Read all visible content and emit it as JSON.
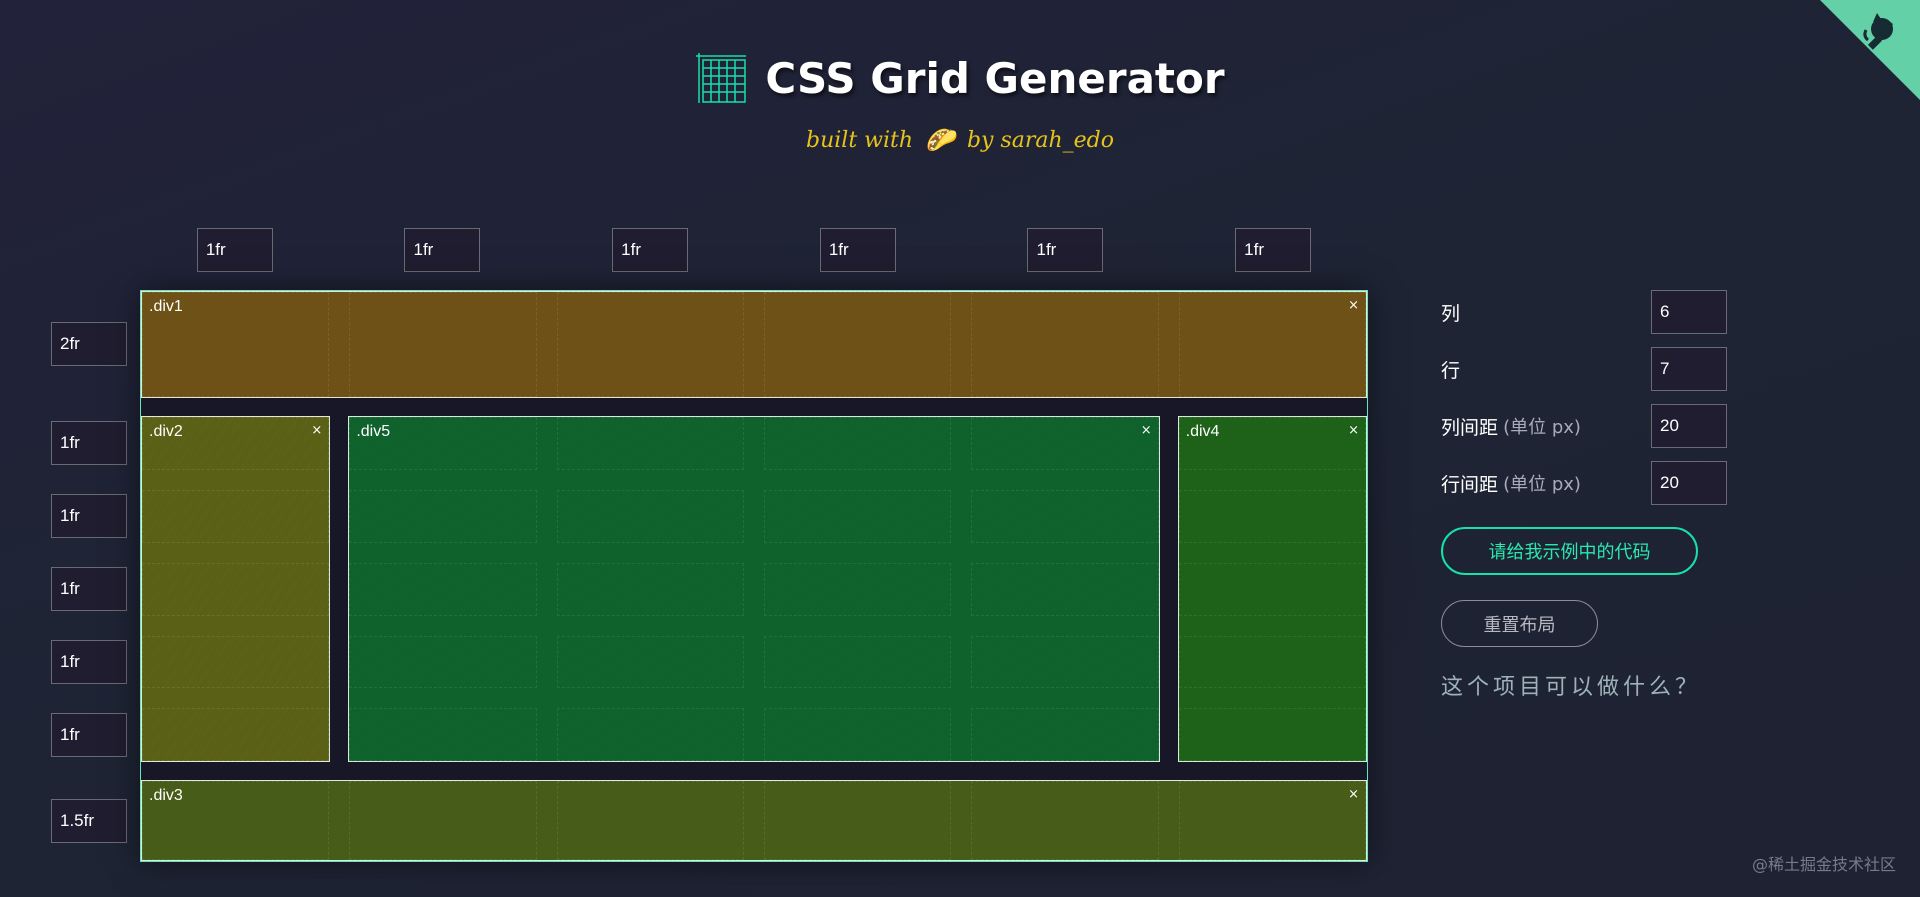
{
  "header": {
    "title": "CSS Grid Generator",
    "subtitle_pre": "built with",
    "subtitle_emoji": "🌮",
    "subtitle_post": "by sarah_edo"
  },
  "columns": [
    "1fr",
    "1fr",
    "1fr",
    "1fr",
    "1fr",
    "1fr"
  ],
  "rows": [
    "2fr",
    "1fr",
    "1fr",
    "1fr",
    "1fr",
    "1fr",
    "1.5fr"
  ],
  "items": [
    {
      "name": ".div1",
      "close": "×"
    },
    {
      "name": ".div2",
      "close": "×"
    },
    {
      "name": ".div5",
      "close": "×"
    },
    {
      "name": ".div4",
      "close": "×"
    },
    {
      "name": ".div3",
      "close": "×"
    }
  ],
  "panel": {
    "columns_label": "列",
    "columns_value": "6",
    "rows_label": "行",
    "rows_value": "7",
    "col_gap_label": "列间距",
    "col_gap_unit": "(单位 px)",
    "col_gap_value": "20",
    "row_gap_label": "行间距",
    "row_gap_unit": "(单位 px)",
    "row_gap_value": "20",
    "code_button": "请给我示例中的代码",
    "reset_button": "重置布局",
    "question": "这个项目可以做什么？"
  },
  "watermark": "@稀土掘金技术社区",
  "colors": {
    "accent": "#19e0a8",
    "corner": "#64d0a8",
    "subtitle": "#e6c31a"
  }
}
